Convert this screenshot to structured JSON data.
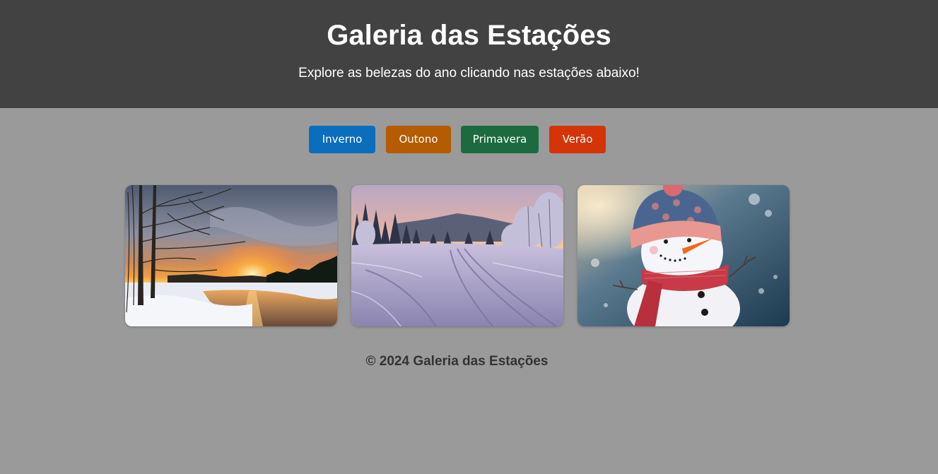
{
  "header": {
    "title": "Galeria das Estações",
    "subtitle": "Explore as belezas do ano clicando nas estações abaixo!"
  },
  "seasons": [
    {
      "label": "Inverno",
      "color": "#0a6ebd"
    },
    {
      "label": "Outono",
      "color": "#b35c00"
    },
    {
      "label": "Primavera",
      "color": "#1c6b3e"
    },
    {
      "label": "Verão",
      "color": "#d43408"
    }
  ],
  "gallery": {
    "active_season": "Inverno",
    "images": [
      {
        "subject": "winter-sunset-river"
      },
      {
        "subject": "snowy-forest-path"
      },
      {
        "subject": "snowman"
      }
    ]
  },
  "footer": {
    "text": "© 2024 Galeria das Estações"
  }
}
